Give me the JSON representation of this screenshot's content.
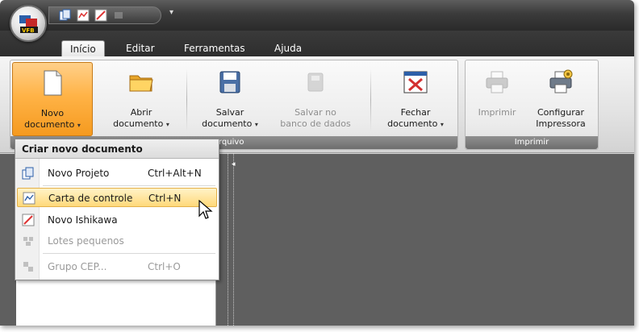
{
  "app": {
    "tabs": [
      {
        "label": "Início",
        "active": true
      },
      {
        "label": "Editar",
        "active": false
      },
      {
        "label": "Ferramentas",
        "active": false
      },
      {
        "label": "Ajuda",
        "active": false
      }
    ],
    "qat_dropdown_glyph": "▾"
  },
  "ribbon": {
    "groups": [
      {
        "label": "Arquivo",
        "label_visible": "rquivo",
        "buttons": [
          {
            "label_line1": "Novo",
            "label_line2": "documento",
            "has_dropdown": true,
            "state": "pressed",
            "icon": "new-document-icon"
          },
          {
            "label_line1": "Abrir",
            "label_line2": "documento",
            "has_dropdown": true,
            "state": "normal",
            "icon": "folder-icon"
          },
          {
            "label_line1": "Salvar",
            "label_line2": "documento",
            "has_dropdown": true,
            "state": "normal",
            "icon": "floppy-disk-icon"
          },
          {
            "label_line1": "Salvar no",
            "label_line2": "banco de dados",
            "has_dropdown": false,
            "state": "disabled",
            "icon": "database-save-icon"
          },
          {
            "label_line1": "Fechar",
            "label_line2": "documento",
            "has_dropdown": true,
            "state": "normal",
            "icon": "close-document-icon"
          }
        ]
      },
      {
        "label": "Imprimir",
        "buttons": [
          {
            "label_line1": "Imprimir",
            "label_line2": "",
            "has_dropdown": false,
            "state": "disabled",
            "icon": "printer-icon"
          },
          {
            "label_line1": "Configurar",
            "label_line2": "Impressora",
            "has_dropdown": false,
            "state": "normal",
            "icon": "printer-settings-icon"
          }
        ]
      }
    ],
    "dropdown_glyph": "▾"
  },
  "menu": {
    "header": "Criar novo documento",
    "items": [
      {
        "label": "Novo Projeto",
        "shortcut": "Ctrl+Alt+N",
        "state": "normal",
        "icon": "project-icon"
      },
      {
        "label": "Carta de controle",
        "shortcut": "Ctrl+N",
        "state": "highlighted",
        "icon": "control-chart-icon"
      },
      {
        "label": "Novo Ishikawa",
        "shortcut": "",
        "state": "normal",
        "icon": "ishikawa-icon"
      },
      {
        "label": "Lotes pequenos",
        "shortcut": "",
        "state": "disabled",
        "icon": "small-batches-icon"
      },
      {
        "label": "Grupo CEP...",
        "shortcut": "Ctrl+O",
        "state": "disabled",
        "icon": "spc-group-icon"
      }
    ]
  },
  "workspace": {
    "splitter_arrow": "◂"
  },
  "colors": {
    "titlebar": "#3b3b3b",
    "ribbon_bg": "#e2e2e2",
    "pressed_button": "#ffb347",
    "menu_highlight": "#ffd97a",
    "group_label_bg": "#7a7a7a",
    "workspace_bg": "#5f5f5f"
  }
}
